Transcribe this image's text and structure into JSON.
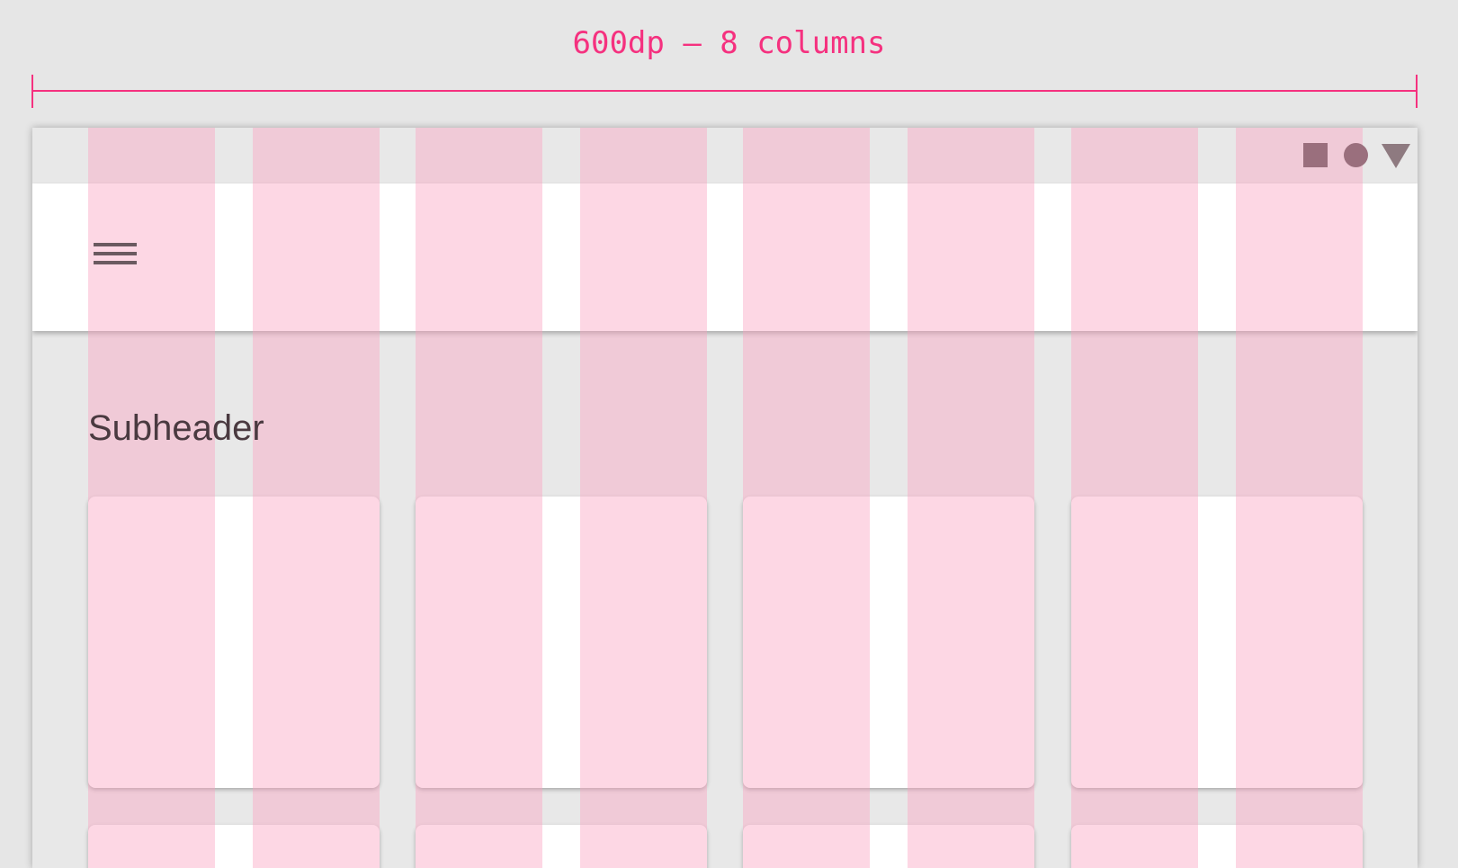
{
  "diagram": {
    "width_label": "600dp – 8 columns",
    "column_count": 8,
    "colors": {
      "accent": "#f5317f",
      "column_overlay": "#faa0be",
      "background": "#e6e6e6",
      "surface": "#ffffff"
    }
  },
  "status_bar": {
    "icons": [
      "square-icon",
      "circle-icon",
      "triangle-icon"
    ]
  },
  "app_bar": {
    "menu_icon": "hamburger-menu-icon"
  },
  "content": {
    "subheader": "Subheader",
    "cards_per_row": 4
  }
}
